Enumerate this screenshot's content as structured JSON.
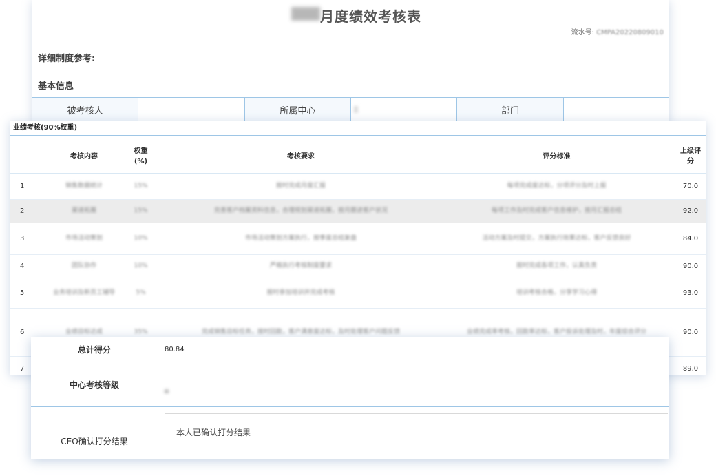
{
  "form": {
    "title": "月度绩效考核表",
    "serial_label": "流水号:",
    "serial_value": "CMPA20220809010",
    "section_policy": "详细制度参考:",
    "section_basic": "基本信息",
    "basic_labels": [
      "被考核人",
      "所属中心",
      "部门"
    ]
  },
  "perf": {
    "section_title": "业绩考核(90%权重)",
    "headers": {
      "content": "考核内容",
      "weight_line1": "权重",
      "weight_line2": "(%)",
      "requirement": "考核要求",
      "criteria": "评分标准",
      "score_line1": "上级评",
      "score_line2": "分"
    },
    "rows": [
      {
        "no": "1",
        "content": "销售数据统计",
        "weight": "15%",
        "requirement": "按时完成月度汇报",
        "criteria": "每项完成度达标，分项评分及时上报",
        "score": "70.0"
      },
      {
        "no": "2",
        "content": "渠道拓展",
        "weight": "15%",
        "requirement": "完善客户档案资料信息，合理规划渠道拓展，按月跟进客户状况",
        "criteria": "每项工作及时完成客户信息维护，按月汇报总结",
        "score": "92.0"
      },
      {
        "no": "3",
        "content": "市场活动策划",
        "weight": "10%",
        "requirement": "市场活动策划方案执行，按季度总结复盘",
        "criteria": "活动方案及时提交，方案执行效果达标，客户反馈良好",
        "score": "84.0"
      },
      {
        "no": "4",
        "content": "团队协作",
        "weight": "10%",
        "requirement": "严格执行考核制度要求",
        "criteria": "按时完成各项工作，认真负责",
        "score": "90.0"
      },
      {
        "no": "5",
        "content": "业务培训及新员工辅导",
        "weight": "5%",
        "requirement": "按时参加培训并完成考核",
        "criteria": "培训考核合格，分享学习心得",
        "score": "93.0"
      },
      {
        "no": "6",
        "content": "业绩目标达成",
        "weight": "35%",
        "requirement": "完成销售目标任务，按时回款，客户满意度达标，及时处理客户问题反馈",
        "criteria": "业绩完成率考核，回款率达标，客户投诉处理及时，年度综合评分",
        "score": "90.0"
      },
      {
        "no": "7",
        "content": "",
        "weight": "",
        "requirement": "",
        "criteria": "",
        "score": "89.0"
      }
    ]
  },
  "summary": {
    "total_label": "总计得分",
    "total_value": "80.84",
    "grade_label": "中心考核等级",
    "grade_value": "",
    "ceo_label": "CEO确认打分结果",
    "ceo_value": "本人已确认打分结果"
  },
  "colors": {
    "border": "#9ec6e6",
    "highlight_row": "#ececec",
    "shadow": "#7896be"
  }
}
